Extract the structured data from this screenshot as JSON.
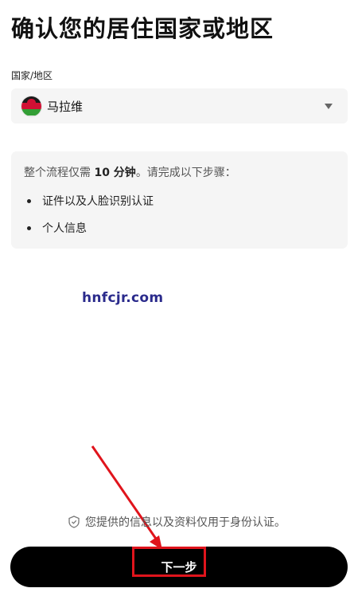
{
  "page": {
    "title": "确认您的居住国家或地区"
  },
  "country": {
    "label": "国家/地区",
    "selected": "马拉维",
    "flag_icon": "malawi-flag-icon"
  },
  "info": {
    "intro_prefix": "整个流程仅需 ",
    "intro_highlight": "10 分钟",
    "intro_suffix": "。请完成以下步骤：",
    "steps": [
      "证件以及人脸识别认证",
      "个人信息"
    ]
  },
  "watermark": "hnfcjr.com",
  "privacy": {
    "text": "您提供的信息以及资料仅用于身份认证。",
    "icon": "shield-icon"
  },
  "button": {
    "next_label": "下一步"
  },
  "colors": {
    "button_bg": "#000000",
    "annotation": "#e0141c",
    "panel_bg": "#f5f5f5"
  }
}
